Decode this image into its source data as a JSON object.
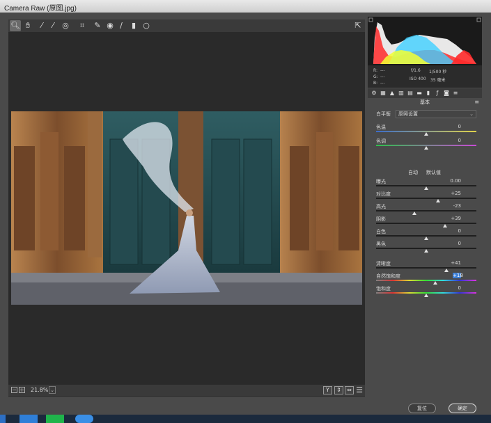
{
  "window": {
    "title": "Camera Raw (原图.jpg)"
  },
  "toolbar": {
    "tools": [
      {
        "name": "zoom-tool",
        "glyph": "🔍︎"
      },
      {
        "name": "hand-tool",
        "glyph": "✋︎"
      },
      {
        "name": "white-balance-tool",
        "glyph": "⁄"
      },
      {
        "name": "color-sampler-tool",
        "glyph": "⁄"
      },
      {
        "name": "targeted-adjustment-tool",
        "glyph": "◎"
      },
      {
        "name": "crop-tool",
        "glyph": "⌗"
      },
      {
        "name": "spot-removal-tool",
        "glyph": "✎"
      },
      {
        "name": "red-eye-tool",
        "glyph": "◉"
      },
      {
        "name": "adjustment-brush-tool",
        "glyph": "∕"
      },
      {
        "name": "graduated-filter-tool",
        "glyph": "▮"
      },
      {
        "name": "radial-filter-tool",
        "glyph": "○"
      }
    ],
    "fullscreen_glyph": "⇱"
  },
  "histogram": {
    "r_label": "R:",
    "r_value": "---",
    "g_label": "G:",
    "g_value": "---",
    "b_label": "B:",
    "b_value": "---",
    "aperture": "f/1.6",
    "shutter": "1/500 秒",
    "iso": "ISO 400",
    "focal": "35 毫米"
  },
  "panel": {
    "section_title": "基本",
    "white_balance_label": "白平衡",
    "white_balance_value": "原照设置",
    "auto_label": "自动",
    "default_label": "默认值",
    "sliders": [
      {
        "label": "色温",
        "value": "0",
        "pos": 0.5
      },
      {
        "label": "色调",
        "value": "0",
        "pos": 0.5
      },
      {
        "label": "曝光",
        "value": "0.00",
        "pos": 0.5
      },
      {
        "label": "对比度",
        "value": "+25",
        "pos": 0.62
      },
      {
        "label": "高光",
        "value": "-23",
        "pos": 0.38
      },
      {
        "label": "阴影",
        "value": "+39",
        "pos": 0.69
      },
      {
        "label": "白色",
        "value": "0",
        "pos": 0.5
      },
      {
        "label": "黑色",
        "value": "0",
        "pos": 0.5
      },
      {
        "label": "清晰度",
        "value": "+41",
        "pos": 0.7
      },
      {
        "label": "自然饱和度",
        "value": "+18",
        "pos": 0.59
      },
      {
        "label": "饱和度",
        "value": "0",
        "pos": 0.5
      }
    ]
  },
  "statusbar": {
    "zoom": "21.8%"
  },
  "buttons": {
    "reset": "复位",
    "ok": "确定"
  },
  "colors": {
    "accent": "#3d7fd6",
    "panel_bg": "#4a4a4a",
    "preview_bg": "#2a2a2a"
  }
}
